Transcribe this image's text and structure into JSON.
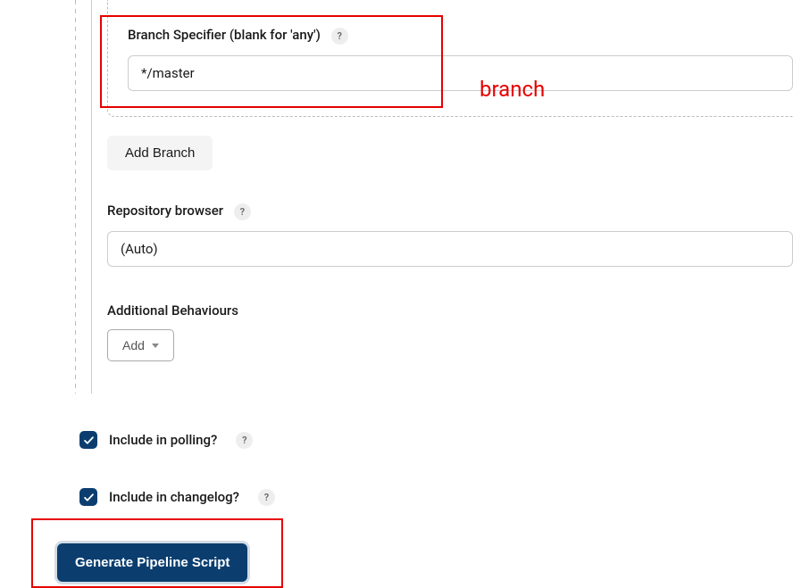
{
  "annotation": {
    "branch_text": "branch"
  },
  "branch": {
    "label": "Branch Specifier (blank for 'any')",
    "value": "*/master"
  },
  "addBranch": {
    "label": "Add Branch"
  },
  "repoBrowser": {
    "label": "Repository browser",
    "value": "(Auto)"
  },
  "additionalBehaviours": {
    "label": "Additional Behaviours",
    "addLabel": "Add"
  },
  "polling": {
    "label": "Include in polling?",
    "checked": true
  },
  "changelog": {
    "label": "Include in changelog?",
    "checked": true
  },
  "generate": {
    "label": "Generate Pipeline Script"
  },
  "help_glyph": "?"
}
